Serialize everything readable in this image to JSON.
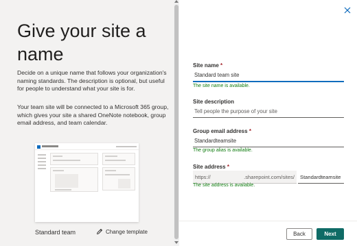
{
  "left": {
    "title": "Give your site a name",
    "description1": "Decide on a unique name that follows your organization's naming standards. The description is optional, but useful for people to understand what your site is for.",
    "description2": "Your team site will be connected to a Microsoft 365 group, which gives your site a shared OneNote notebook, group email address, and team calendar.",
    "template_label": "Standard team",
    "change_template": "Change template",
    "change_template_icon": "pencil-icon"
  },
  "form": {
    "site_name": {
      "label": "Site name",
      "required_mark": "*",
      "value": "Standard team site",
      "status": "The site name is available."
    },
    "site_description": {
      "label": "Site description",
      "placeholder": "Tell people the purpose of your site"
    },
    "group_email": {
      "label": "Group email address",
      "required_mark": "*",
      "value": "Standardteamsite",
      "status": "The group alias is available."
    },
    "site_address": {
      "label": "Site address",
      "required_mark": "*",
      "prefix": "https://",
      "domain": ".sharepoint.com/sites/",
      "value": "Standardteamsite",
      "status": "The site address is available."
    }
  },
  "buttons": {
    "back": "Back",
    "next": "Next"
  },
  "colors": {
    "accent": "#0f6cbd",
    "primary_button": "#0f6b66",
    "success": "#107c10",
    "required": "#a4262c"
  }
}
